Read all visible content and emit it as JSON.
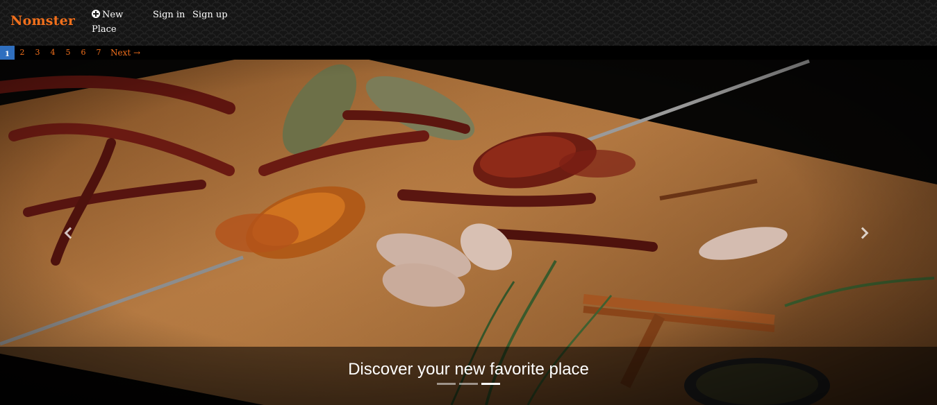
{
  "navbar": {
    "brand": "Nomster",
    "new_place": "New Place",
    "sign_in": "Sign in",
    "sign_up": "Sign up",
    "icons": {
      "new_place": "plus-circle-icon"
    }
  },
  "pagination": {
    "current": "1",
    "pages": [
      "2",
      "3",
      "4",
      "5",
      "6",
      "7"
    ],
    "next": "Next →"
  },
  "carousel": {
    "caption": "Discover your new favorite place",
    "slide_count": 3,
    "active_slide": 3,
    "icons": {
      "prev": "chevron-left-icon",
      "next": "chevron-right-icon"
    }
  },
  "colors": {
    "brand": "#f2701c",
    "pagination_current": "#2f6fbf",
    "navbar_bg": "#151515"
  }
}
